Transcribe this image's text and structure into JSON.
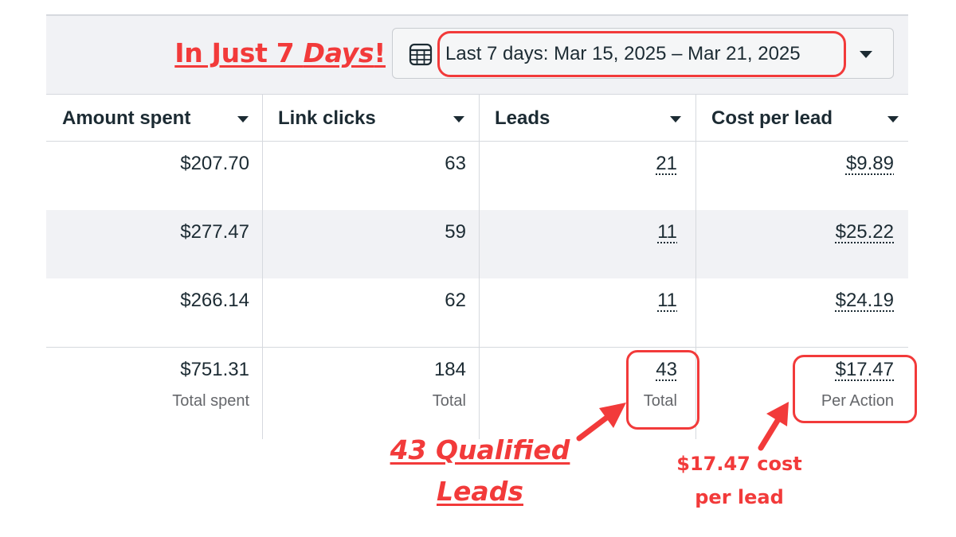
{
  "headline": {
    "prefix": "In Just 7 ",
    "emphasis": "Days",
    "suffix": "!"
  },
  "date_range": {
    "label": "Last 7 days: Mar 15, 2025 – Mar 21, 2025",
    "icon": "calendar-icon"
  },
  "columns": [
    {
      "label": "Amount spent"
    },
    {
      "label": "Link clicks"
    },
    {
      "label": "Leads"
    },
    {
      "label": "Cost per lead"
    }
  ],
  "rows": [
    {
      "amount_spent": "$207.70",
      "link_clicks": "63",
      "leads": "21",
      "cost_per_lead": "$9.89"
    },
    {
      "amount_spent": "$277.47",
      "link_clicks": "59",
      "leads": "11",
      "cost_per_lead": "$25.22"
    },
    {
      "amount_spent": "$266.14",
      "link_clicks": "62",
      "leads": "11",
      "cost_per_lead": "$24.19"
    }
  ],
  "totals": {
    "amount_spent": "$751.31",
    "amount_spent_sub": "Total spent",
    "link_clicks": "184",
    "link_clicks_sub": "Total",
    "leads": "43",
    "leads_sub": "Total",
    "cost_per_lead": "$17.47",
    "cost_per_lead_sub": "Per Action"
  },
  "annotations": {
    "leads_line1": "43 Qualified",
    "leads_line2": "Leads",
    "cost_line1": "$17.47 cost",
    "cost_line2": "per lead"
  },
  "colors": {
    "annotation": "#f23a3a",
    "alt_row": "#f1f2f5",
    "text": "#1c2b33",
    "muted": "#65676b"
  }
}
